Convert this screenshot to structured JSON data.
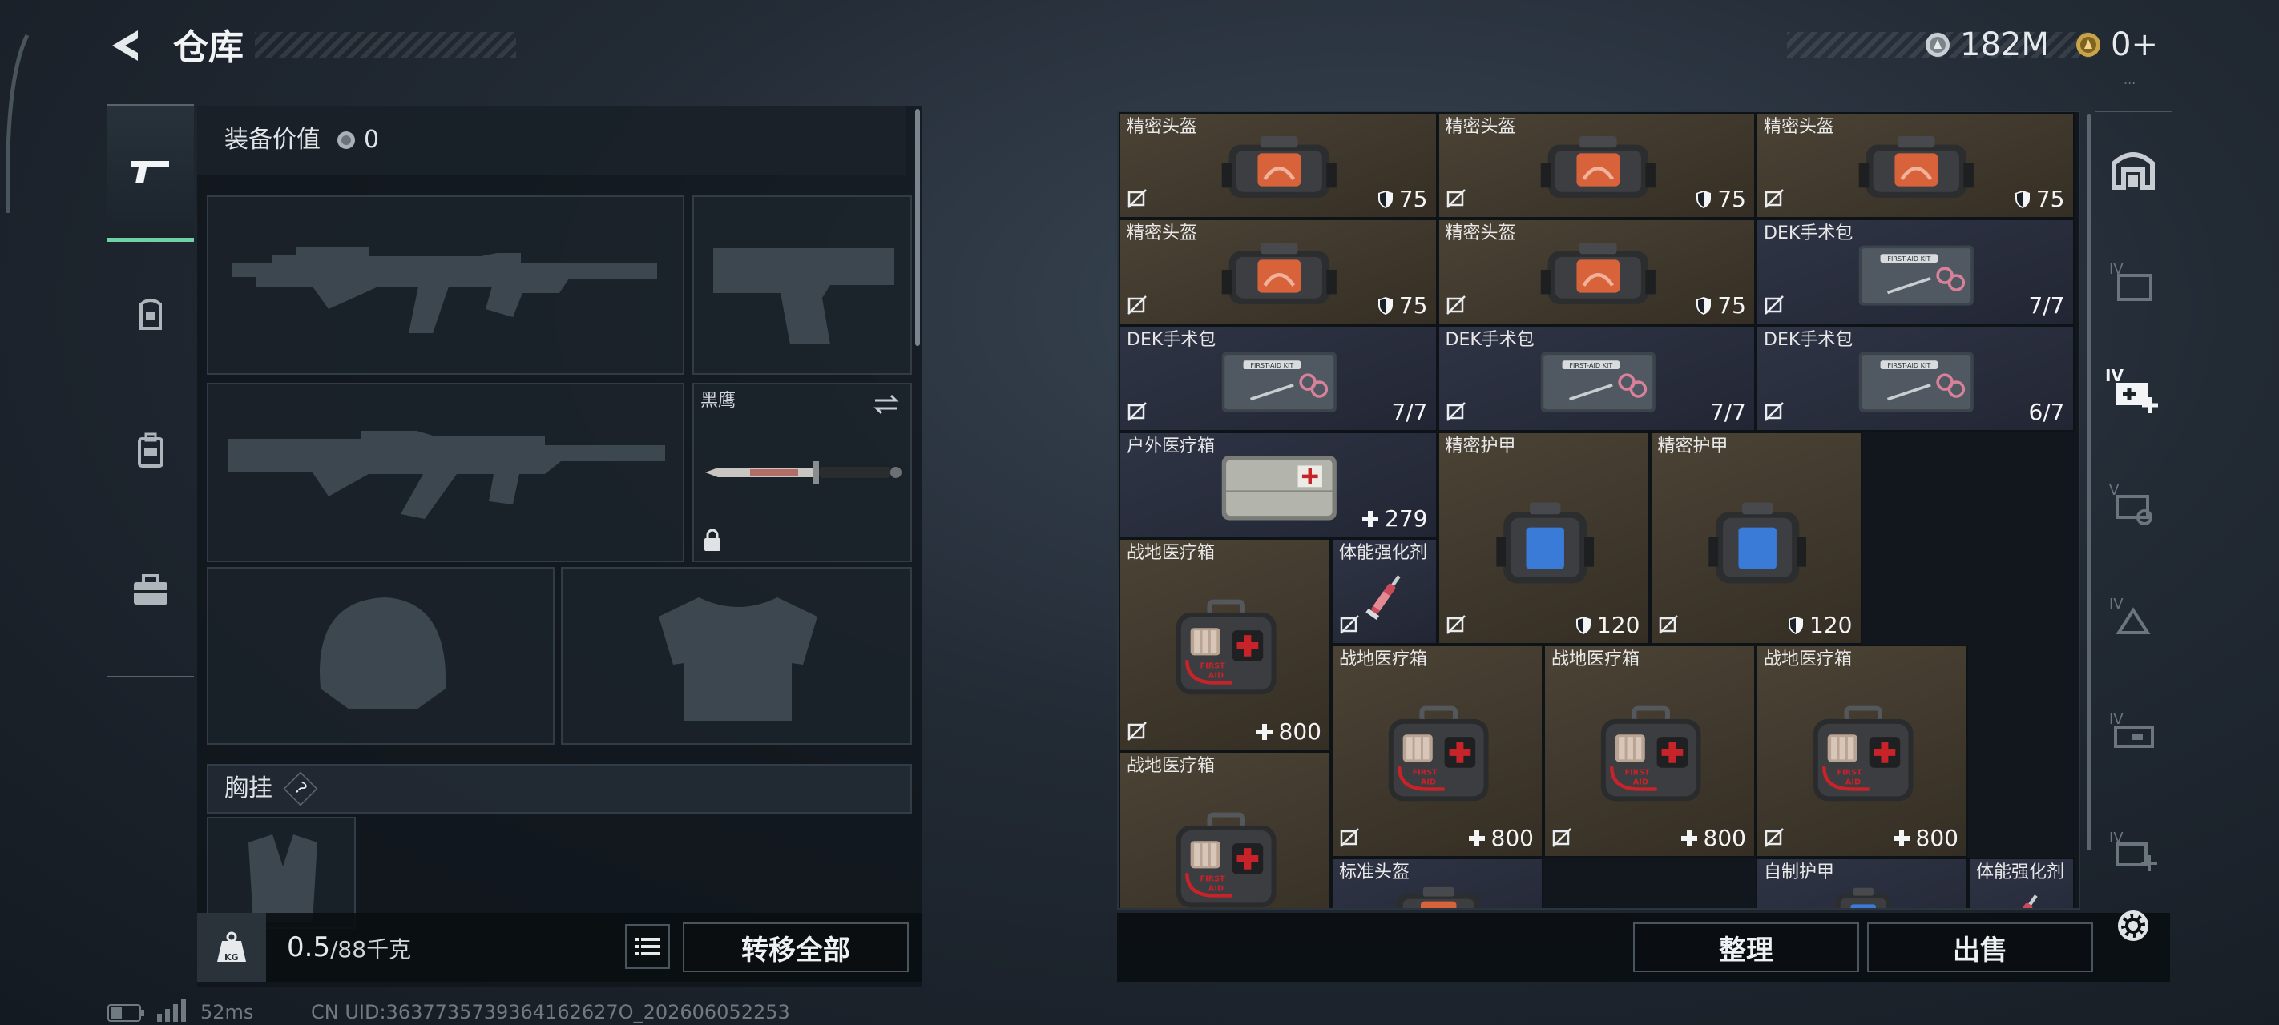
{
  "header": {
    "title": "仓库",
    "currency_1": "182M",
    "currency_2": "0+",
    "currency_2_sub": "..."
  },
  "left_tabs": [
    {
      "icon": "pistol-icon",
      "active": true
    },
    {
      "icon": "helmet-icon",
      "active": false
    },
    {
      "icon": "backpack-icon",
      "active": false
    },
    {
      "icon": "toolbox-icon",
      "active": false
    }
  ],
  "equipment": {
    "value_label": "装备价值",
    "value": "0",
    "melee_name": "黑鹰",
    "chest_rig_label": "胸挂",
    "chest_rig_help": "?",
    "weight_current": "0.5",
    "weight_max": "/88千克",
    "weight_icon_text": "KG",
    "transfer_all": "转移全部"
  },
  "stash": {
    "items": [
      {
        "name": "精密头盔",
        "value": "75",
        "kind": "helmet"
      },
      {
        "name": "精密头盔",
        "value": "75",
        "kind": "helmet"
      },
      {
        "name": "精密头盔",
        "value": "75",
        "kind": "helmet"
      },
      {
        "name": "精密头盔",
        "value": "75",
        "kind": "helmet"
      },
      {
        "name": "精密头盔",
        "value": "75",
        "kind": "helmet"
      },
      {
        "name": "DEK手术包",
        "value": "7/7",
        "kind": "surgery"
      },
      {
        "name": "DEK手术包",
        "value": "7/7",
        "kind": "surgery"
      },
      {
        "name": "DEK手术包",
        "value": "7/7",
        "kind": "surgery"
      },
      {
        "name": "DEK手术包",
        "value": "6/7",
        "kind": "surgery"
      },
      {
        "name": "户外医疗箱",
        "value": "279",
        "kind": "medbox"
      },
      {
        "name": "精密护甲",
        "value": "120",
        "kind": "armor"
      },
      {
        "name": "精密护甲",
        "value": "120",
        "kind": "armor"
      },
      {
        "name": "战地医疗箱",
        "value": "800",
        "kind": "firstaid"
      },
      {
        "name": "体能强化剂",
        "value": "",
        "kind": "syringe"
      },
      {
        "name": "战地医疗箱",
        "value": "800",
        "kind": "firstaid"
      },
      {
        "name": "战地医疗箱",
        "value": "800",
        "kind": "firstaid"
      },
      {
        "name": "战地医疗箱",
        "value": "800",
        "kind": "firstaid"
      },
      {
        "name": "战地医疗箱",
        "value": "",
        "kind": "firstaid"
      },
      {
        "name": "标准头盔",
        "value": "",
        "kind": "helmet"
      },
      {
        "name": "自制护甲",
        "value": "",
        "kind": "armor"
      },
      {
        "name": "体能强化剂",
        "value": "",
        "kind": "syringe"
      }
    ],
    "first_aid_text_1": "FIRST",
    "first_aid_text_2": "AID",
    "kit_text": "FIRST-AID KIT",
    "sort_button": "整理",
    "sell_button": "出售"
  },
  "right_tabs": [
    "IV",
    "IV",
    "V",
    "IV",
    "IV",
    "IV"
  ],
  "status_bar": {
    "ping": "52ms",
    "uid": "CN UID:3637735739364162627O_202606052253"
  },
  "colors": {
    "accent": "#6fd1a5",
    "shield_helmet": "#d8633a",
    "shield_armor": "#3a7bd8",
    "first_aid_red": "#c9232a"
  }
}
